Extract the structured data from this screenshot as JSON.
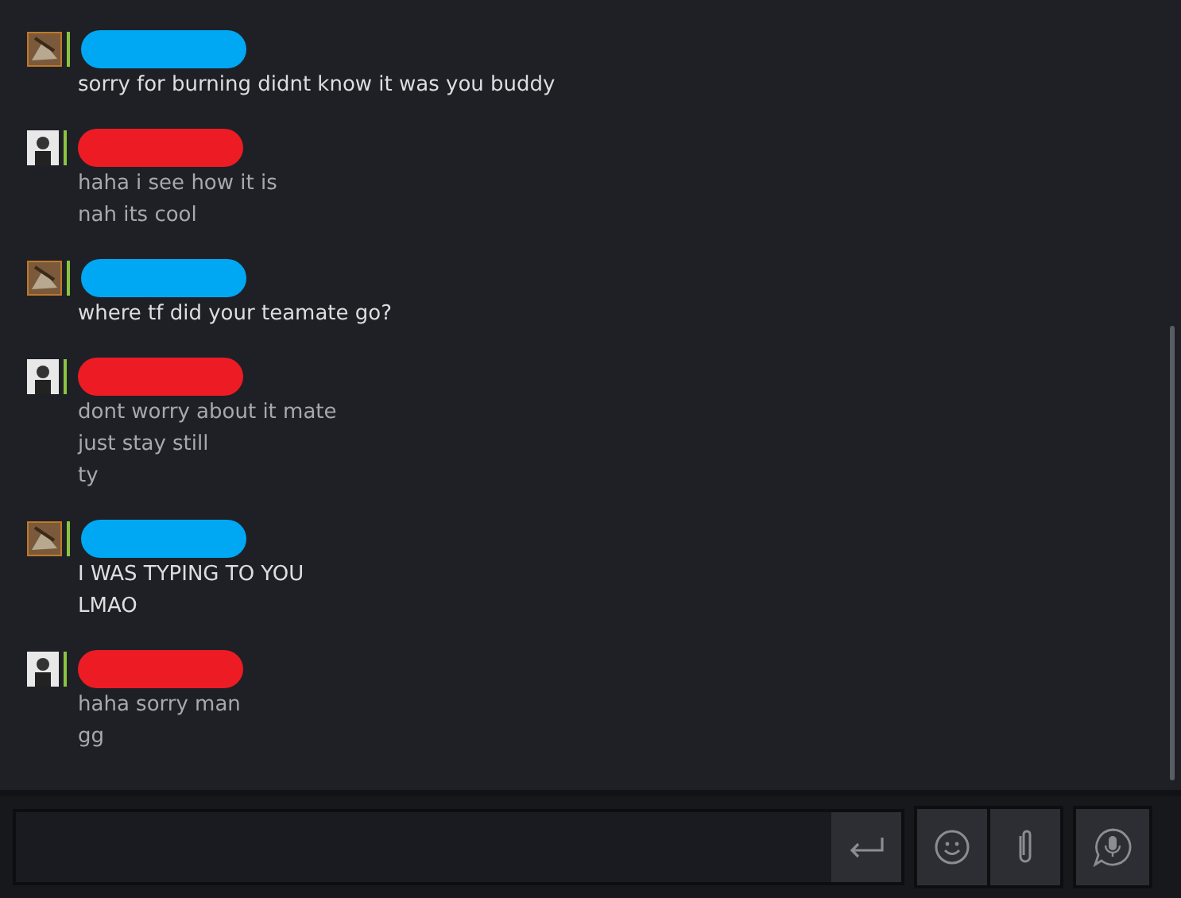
{
  "messages": [
    {
      "kind": "friend",
      "color": "#00a8f3",
      "lines": [
        "sorry for burning didnt know it was you buddy"
      ]
    },
    {
      "kind": "self",
      "color": "#ed1c24",
      "lines": [
        "haha i see how it is",
        "nah its cool"
      ]
    },
    {
      "kind": "friend",
      "color": "#00a8f3",
      "lines": [
        "where tf did your teamate go?"
      ]
    },
    {
      "kind": "self",
      "color": "#ed1c24",
      "lines": [
        "dont worry about it mate",
        "just stay still",
        "ty"
      ]
    },
    {
      "kind": "friend",
      "color": "#00a8f3",
      "lines": [
        "I WAS TYPING TO YOU",
        "LMAO"
      ]
    },
    {
      "kind": "self",
      "color": "#ed1c24",
      "lines": [
        "haha sorry man",
        "gg"
      ]
    }
  ]
}
